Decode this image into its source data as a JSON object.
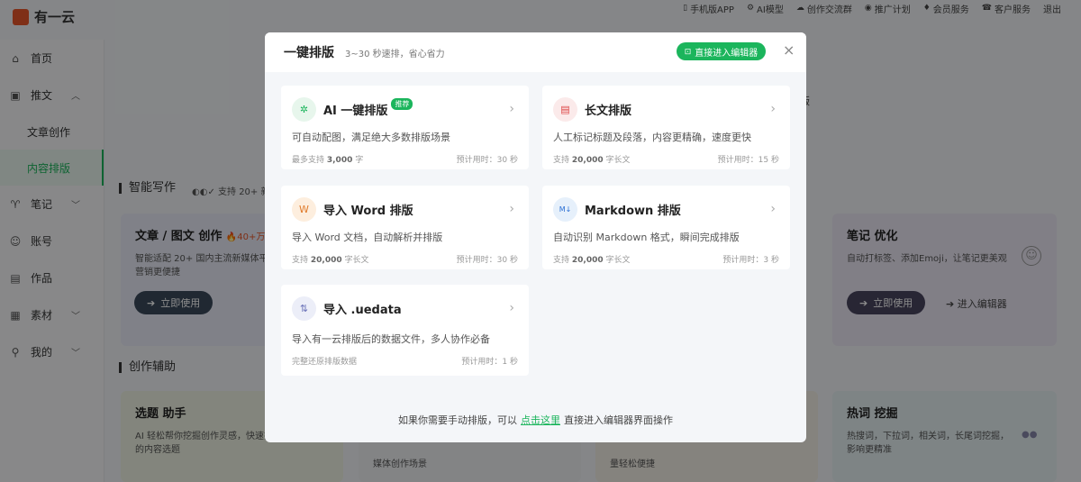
{
  "app": {
    "logo_text": "有一云"
  },
  "topbar": [
    {
      "icon": "▯",
      "label": "手机版APP"
    },
    {
      "icon": "⚙",
      "label": "AI模型"
    },
    {
      "icon": "☁",
      "label": "创作交流群"
    },
    {
      "icon": "◉",
      "label": "推广计划"
    },
    {
      "icon": "♦",
      "label": "会员服务"
    },
    {
      "icon": "☎",
      "label": "客户服务"
    },
    {
      "icon": "",
      "label": "退出"
    }
  ],
  "sidebar": {
    "home": "首页",
    "article": "推文",
    "sub_create": "文章创作",
    "sub_layout": "内容排版",
    "notes": "笔记",
    "account": "账号",
    "works": "作品",
    "material": "素材",
    "mine": "我的"
  },
  "main": {
    "smart_writing": "智能写作",
    "smart_badge": "支持 20+ 新",
    "card1_title": "文章 / 图文 创作",
    "card1_hot": "🔥40+万人",
    "card1_desc": "智能适配 20+ 国内主流新媒体平台\n营销更便捷",
    "card1_btn": "立即使用",
    "card_right_title": "笔记 优化",
    "card_right_desc": "自动打标签、添加Emoji，让笔记更美观",
    "card_right_btn": "立即使用",
    "card_right_link": "进入编辑器",
    "assist": "创作辅助",
    "assist1_title": "选题 助手",
    "assist1_desc": "AI 轻松帮你挖掘创作灵感，快速找\n的内容选题",
    "assist2_desc": "媒体创作场景",
    "assist3_desc": "量轻松便捷",
    "assist4_title": "热词 挖掘",
    "assist4_desc": "热搜词，下拉词，相关词，长尾词挖掘，\n影响更精准",
    "peek_text": "机版"
  },
  "modal": {
    "title": "一键排版",
    "subtitle": "3~30 秒速排，省心省力",
    "editor_btn": "直接进入编辑器",
    "close": "×",
    "options": [
      {
        "name": "AI 一键排版",
        "tag": "推荐",
        "desc": "可自动配图，满足绝大多数排版场景",
        "support_pre": "最多支持 ",
        "support_num": "3,000",
        "support_post": " 字",
        "time": "预计用时：30 秒"
      },
      {
        "name": "长文排版",
        "tag": "",
        "desc": "人工标记标题及段落，内容更精确，速度更快",
        "support_pre": "支持 ",
        "support_num": "20,000",
        "support_post": " 字长文",
        "time": "预计用时：15 秒"
      },
      {
        "name": "导入 Word 排版",
        "tag": "",
        "desc": "导入 Word 文档，自动解析并排版",
        "support_pre": "支持 ",
        "support_num": "20,000",
        "support_post": " 字长文",
        "time": "预计用时：30 秒"
      },
      {
        "name": "Markdown 排版",
        "tag": "",
        "desc": "自动识别 Markdown 格式，瞬间完成排版",
        "support_pre": "支持 ",
        "support_num": "20,000",
        "support_post": " 字长文",
        "time": "预计用时：3 秒"
      },
      {
        "name": "导入 .uedata",
        "tag": "",
        "desc": "导入有一云排版后的数据文件，多人协作必备",
        "support_pre": "完整还原排版数据",
        "support_num": "",
        "support_post": "",
        "time": "预计用时：1 秒"
      }
    ],
    "footer_pre": "如果你需要手动排版，可以",
    "footer_link": "点击这里",
    "footer_post": "直接进入编辑器界面操作"
  },
  "colors": {
    "accent": "#1bb55c",
    "overlay": "rgba(0,0,0,0.45)"
  }
}
